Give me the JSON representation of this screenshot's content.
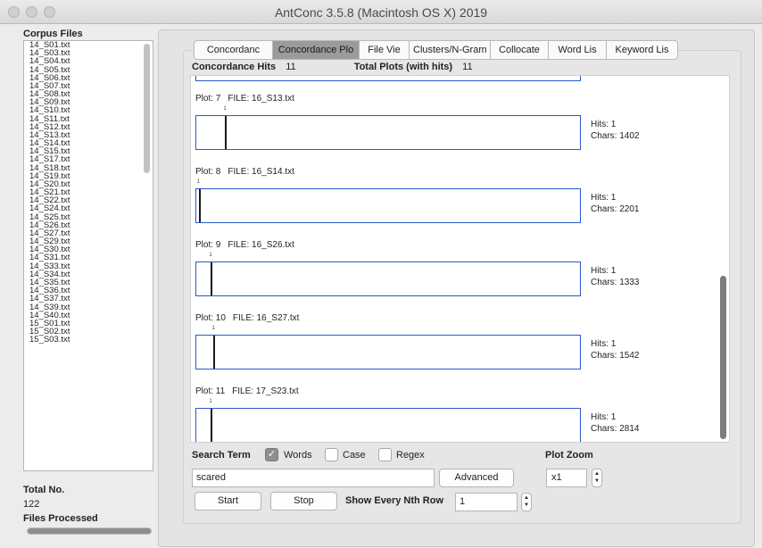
{
  "window": {
    "title": "AntConc 3.5.8 (Macintosh OS X) 2019"
  },
  "sidebar": {
    "corpus_label": "Corpus Files",
    "files": [
      "14_S01.txt",
      "14_S03.txt",
      "14_S04.txt",
      "14_S05.txt",
      "14_S06.txt",
      "14_S07.txt",
      "14_S08.txt",
      "14_S09.txt",
      "14_S10.txt",
      "14_S11.txt",
      "14_S12.txt",
      "14_S13.txt",
      "14_S14.txt",
      "14_S15.txt",
      "14_S17.txt",
      "14_S18.txt",
      "14_S19.txt",
      "14_S20.txt",
      "14_S21.txt",
      "14_S22.txt",
      "14_S24.txt",
      "14_S25.txt",
      "14_S26.txt",
      "14_S27.txt",
      "14_S29.txt",
      "14_S30.txt",
      "14_S31.txt",
      "14_S33.txt",
      "14_S34.txt",
      "14_S35.txt",
      "14_S36.txt",
      "14_S37.txt",
      "14_S39.txt",
      "14_S40.txt",
      "15_S01.txt",
      "15_S02.txt",
      "15_S03.txt"
    ],
    "total_label": "Total No.",
    "total_value": "122",
    "processed_label": "Files Processed",
    "processed_fraction": 1.0
  },
  "tabs": [
    {
      "label": "Concordanc",
      "active": false
    },
    {
      "label": "Concordance Plo",
      "active": true
    },
    {
      "label": "File Vie",
      "active": false
    },
    {
      "label": "Clusters/N-Gram",
      "active": false
    },
    {
      "label": "Collocate",
      "active": false
    },
    {
      "label": "Word Lis",
      "active": false
    },
    {
      "label": "Keyword Lis",
      "active": false
    }
  ],
  "summary": {
    "hits_label": "Concordance Hits",
    "hits_value": "11",
    "plots_label": "Total Plots (with hits)",
    "plots_value": "11"
  },
  "plots": [
    {
      "plot_label": "Plot: 7",
      "file_label": "FILE: 16_S13.txt",
      "hits": "Hits: 1",
      "chars": "Chars: 1402",
      "tick": "1",
      "position": 0.075
    },
    {
      "plot_label": "Plot: 8",
      "file_label": "FILE: 16_S14.txt",
      "hits": "Hits: 1",
      "chars": "Chars: 2201",
      "tick": "1",
      "position": 0.006
    },
    {
      "plot_label": "Plot: 9",
      "file_label": "FILE: 16_S26.txt",
      "hits": "Hits: 1",
      "chars": "Chars: 1333",
      "tick": "1",
      "position": 0.038
    },
    {
      "plot_label": "Plot: 10",
      "file_label": "FILE: 16_S27.txt",
      "hits": "Hits: 1",
      "chars": "Chars: 1542",
      "tick": "1",
      "position": 0.045
    },
    {
      "plot_label": "Plot: 11",
      "file_label": "FILE: 17_S23.txt",
      "hits": "Hits: 1",
      "chars": "Chars: 2814",
      "tick": "1",
      "position": 0.038
    }
  ],
  "search": {
    "label": "Search Term",
    "words_label": "Words",
    "words_checked": true,
    "case_label": "Case",
    "case_checked": false,
    "regex_label": "Regex",
    "regex_checked": false,
    "term": "scared",
    "advanced_label": "Advanced",
    "start_label": "Start",
    "stop_label": "Stop",
    "nth_label": "Show Every Nth Row",
    "nth_value": "1"
  },
  "zoom": {
    "label": "Plot Zoom",
    "value": "x1"
  }
}
